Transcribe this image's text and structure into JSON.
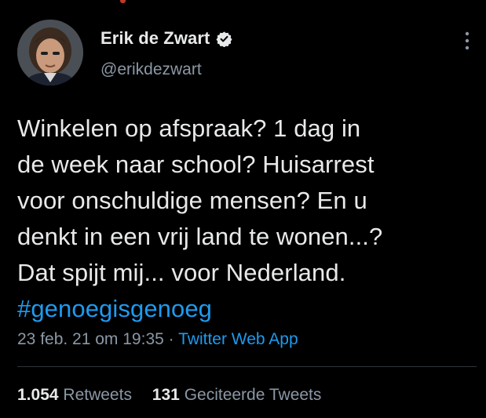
{
  "author": {
    "display_name": "Erik de Zwart",
    "handle": "@erikdezwart",
    "verified": true
  },
  "tweet": {
    "lines": [
      "Winkelen op afspraak? 1 dag in",
      "de week naar school? Huisarrest",
      "voor onschuldige mensen? En u",
      "denkt in een vrij land te wonen...?",
      "Dat spijt mij... voor Nederland."
    ],
    "hashtag": "#genoegisgenoeg"
  },
  "meta": {
    "timestamp": "23 feb. 21 om 19:35",
    "separator": " · ",
    "source": "Twitter Web App"
  },
  "stats": {
    "retweets_count": "1.054",
    "retweets_label": "Retweets",
    "quotes_count": "131",
    "quotes_label": "Geciteerde Tweets"
  },
  "colors": {
    "background": "#000000",
    "text": "#e7e9ea",
    "secondary": "#8b98a5",
    "link": "#1d9bf0",
    "divider": "#2f3336"
  },
  "icons": {
    "verified": "verified-badge-icon",
    "more": "more-vertical-icon"
  }
}
